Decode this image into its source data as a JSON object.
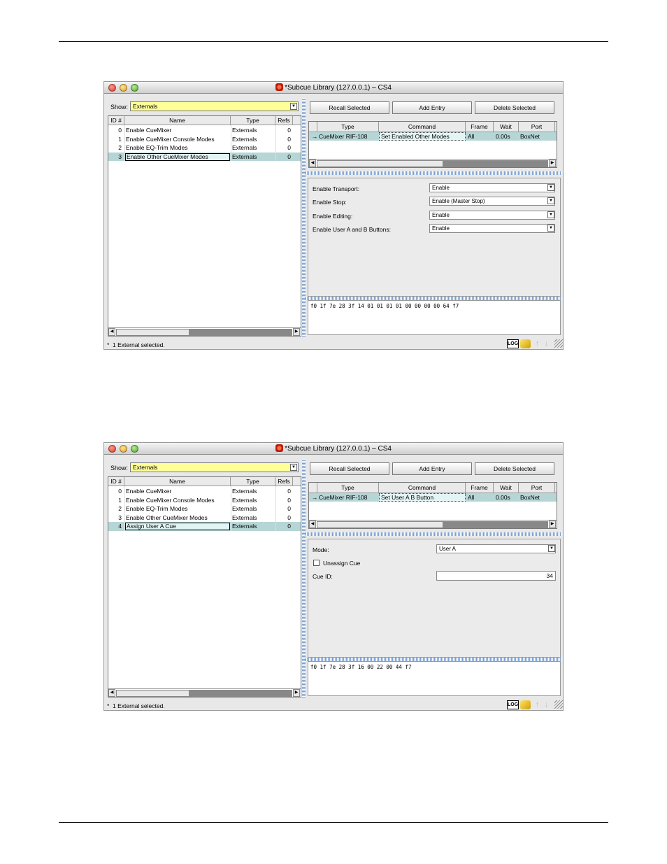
{
  "windows": [
    {
      "title": "*Subcue Library (127.0.0.1) – CS4",
      "show_label": "Show:",
      "show_value": "Externals",
      "list_headers": {
        "id": "ID #",
        "name": "Name",
        "type": "Type",
        "refs": "Refs"
      },
      "list_rows": [
        {
          "id": "0",
          "name": "Enable CueMixer",
          "type": "Externals",
          "refs": "0"
        },
        {
          "id": "1",
          "name": "Enable CueMixer Console Modes",
          "type": "Externals",
          "refs": "0"
        },
        {
          "id": "2",
          "name": "Enable EQ-Trim Modes",
          "type": "Externals",
          "refs": "0"
        },
        {
          "id": "3",
          "name": "Enable Other CueMixer Modes",
          "type": "Externals",
          "refs": "0",
          "selected": true
        }
      ],
      "buttons": {
        "recall": "Recall Selected",
        "add": "Add Entry",
        "delete": "Delete Selected"
      },
      "entry_headers": {
        "type": "Type",
        "command": "Command",
        "frame": "Frame",
        "wait": "Wait",
        "port": "Port"
      },
      "entry_row": {
        "arrow": "→",
        "type": "CueMixer RIF-108",
        "command": "Set Enabled Other Modes",
        "frame": "All",
        "wait": "0.00s",
        "port": "BoxNet"
      },
      "params": {
        "transport_label": "Enable Transport:",
        "transport_value": "Enable",
        "stop_label": "Enable Stop:",
        "stop_value": "Enable (Master Stop)",
        "editing_label": "Enable Editing:",
        "editing_value": "Enable",
        "userab_label": "Enable User A and B Buttons:",
        "userab_value": "Enable"
      },
      "hex": "f0 1f 7e 28 3f 14 01 01 01 01 00 00 00 00 64 f7",
      "status": "1 External selected.",
      "status_mark": "*",
      "log_label": "LOG"
    },
    {
      "title": "*Subcue Library (127.0.0.1) – CS4",
      "show_label": "Show:",
      "show_value": "Externals",
      "list_headers": {
        "id": "ID #",
        "name": "Name",
        "type": "Type",
        "refs": "Refs"
      },
      "list_rows": [
        {
          "id": "0",
          "name": "Enable CueMixer",
          "type": "Externals",
          "refs": "0"
        },
        {
          "id": "1",
          "name": "Enable CueMixer Console Modes",
          "type": "Externals",
          "refs": "0"
        },
        {
          "id": "2",
          "name": "Enable EQ-Trim Modes",
          "type": "Externals",
          "refs": "0"
        },
        {
          "id": "3",
          "name": "Enable Other CueMixer Modes",
          "type": "Externals",
          "refs": "0"
        },
        {
          "id": "4",
          "name": "Assign User A Cue",
          "type": "Externals",
          "refs": "0",
          "selected": true
        }
      ],
      "buttons": {
        "recall": "Recall Selected",
        "add": "Add Entry",
        "delete": "Delete Selected"
      },
      "entry_headers": {
        "type": "Type",
        "command": "Command",
        "frame": "Frame",
        "wait": "Wait",
        "port": "Port"
      },
      "entry_row": {
        "arrow": "→",
        "type": "CueMixer RIF-108",
        "command": "Set User A B Button",
        "frame": "All",
        "wait": "0.00s",
        "port": "BoxNet"
      },
      "params": {
        "mode_label": "Mode:",
        "mode_value": "User A",
        "unassign_label": "Unassign Cue",
        "unassign_checked": false,
        "cueid_label": "Cue ID:",
        "cueid_value": "34"
      },
      "hex": "f0 1f 7e 28 3f 16 00 22 00 44 f7",
      "status": "1 External selected.",
      "status_mark": "*",
      "log_label": "LOG"
    }
  ],
  "icons": {
    "up": "↑",
    "down": "↓",
    "scroll_left": "◀",
    "scroll_right": "▶",
    "dropdown": "▼"
  }
}
